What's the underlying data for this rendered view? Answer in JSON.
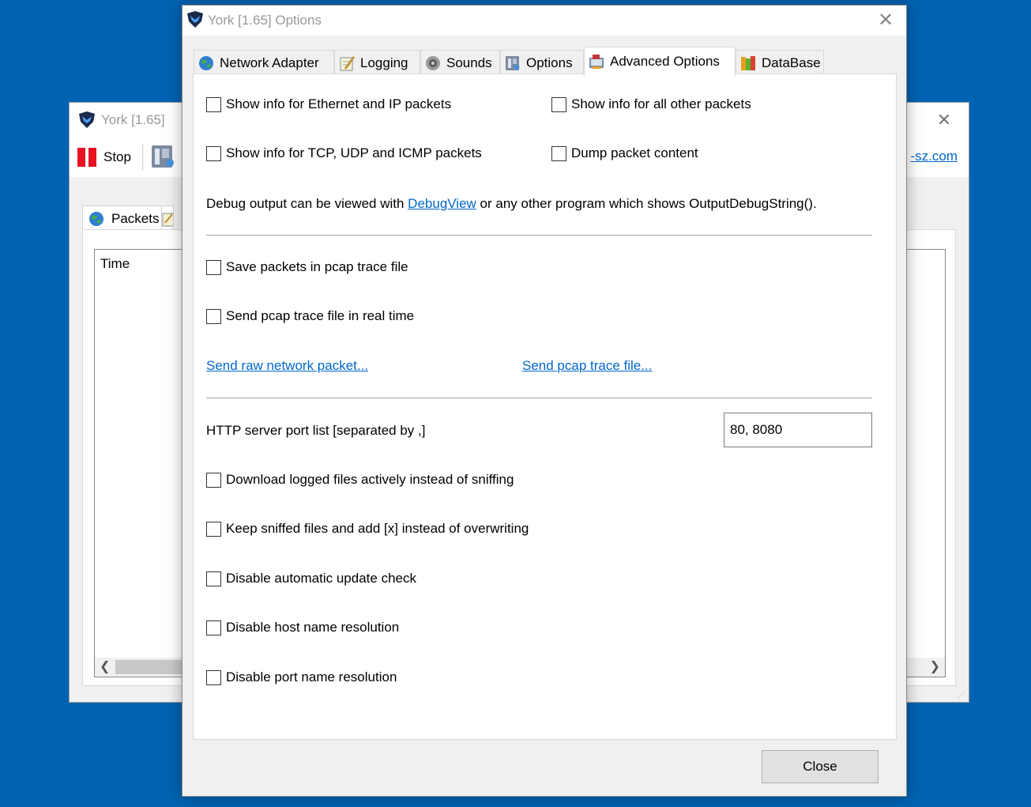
{
  "main_window": {
    "title": "York [1.65]",
    "toolbar": {
      "stop_label": "Stop"
    },
    "link_text": "-sz.com",
    "tabs": [
      {
        "label": "Packets"
      }
    ],
    "list": {
      "column_time": "Time"
    }
  },
  "dialog": {
    "title": "York [1.65] Options",
    "close_glyph": "✕",
    "tabs": [
      {
        "label": "Network Adapter",
        "icon": "globe-icon"
      },
      {
        "label": "Logging",
        "icon": "notepad-icon"
      },
      {
        "label": "Sounds",
        "icon": "speaker-icon"
      },
      {
        "label": "Options",
        "icon": "options-icon"
      },
      {
        "label": "Advanced Options",
        "icon": "advanced-options-icon",
        "active": true
      },
      {
        "label": "DataBase",
        "icon": "database-icon"
      }
    ],
    "checks": {
      "eth_ip": "Show info for Ethernet and IP packets",
      "all_other": "Show info for all other packets",
      "tcp_udp_icmp": "Show info for TCP, UDP and ICMP packets",
      "dump_content": "Dump packet content",
      "save_pcap": "Save packets in pcap trace file",
      "send_pcap_realtime": "Send pcap trace file in real time",
      "download_active": "Download logged files actively instead of sniffing",
      "keep_sniffed": "Keep sniffed files and add [x] instead of overwriting",
      "disable_update": "Disable automatic update check",
      "disable_host": "Disable host name resolution",
      "disable_port": "Disable port name resolution"
    },
    "debug": {
      "prefix": "Debug output can be viewed with ",
      "link": "DebugView",
      "suffix": " or any other program which shows OutputDebugString()."
    },
    "links": {
      "send_raw": "Send raw network packet...",
      "send_pcap": "Send pcap trace file..."
    },
    "http_port": {
      "label": "HTTP server port list [separated by ,]",
      "value": "80, 8080"
    },
    "close_button": "Close"
  },
  "colors": {
    "desktop": "#0063b1",
    "link": "#0066cc",
    "stop_red": "#e81123"
  }
}
